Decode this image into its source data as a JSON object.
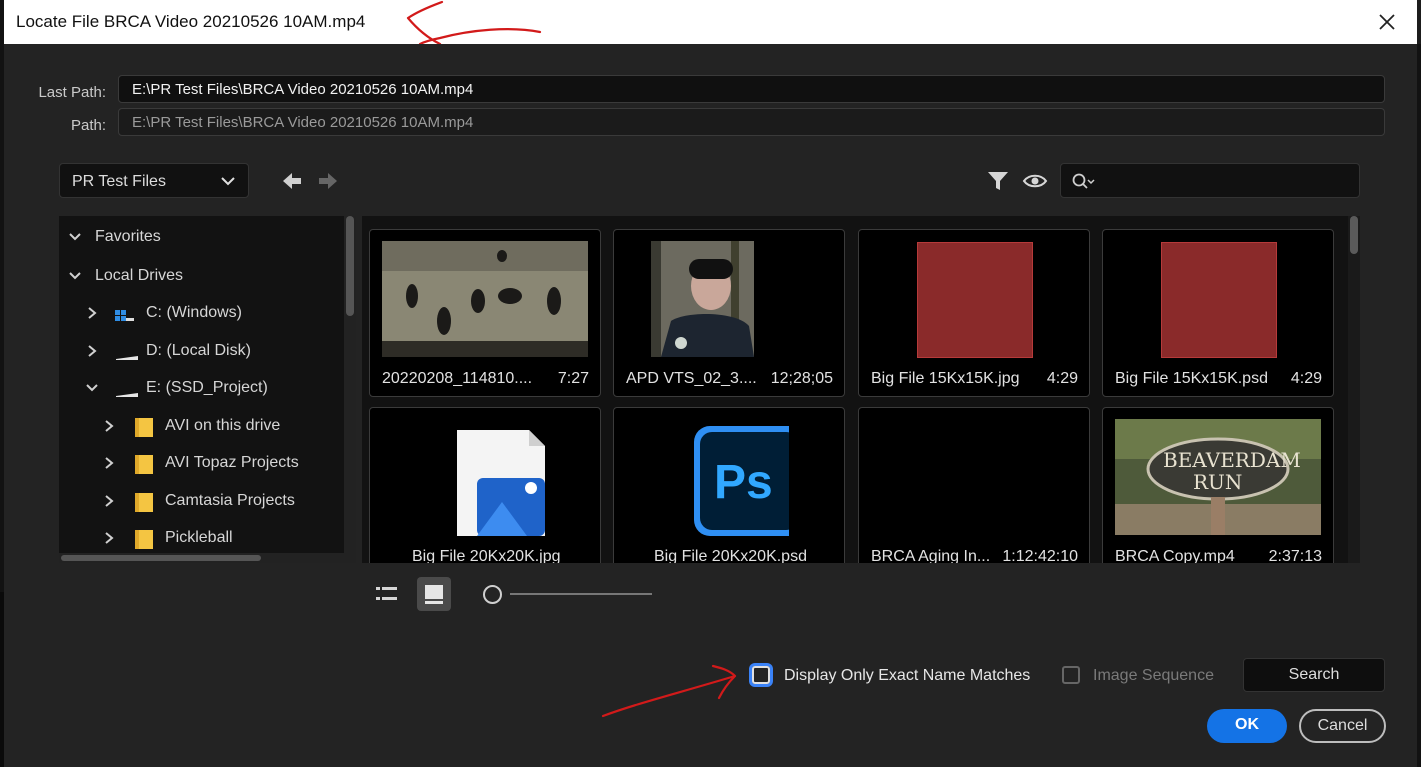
{
  "window": {
    "title": "Locate File BRCA Video 20210526 10AM.mp4"
  },
  "paths": {
    "last_path_label": "Last Path:",
    "last_path_value": "E:\\PR Test Files\\BRCA Video 20210526 10AM.mp4",
    "path_label": "Path:",
    "path_value": "E:\\PR Test Files\\BRCA Video 20210526 10AM.mp4"
  },
  "location": {
    "selected": "PR Test Files"
  },
  "search": {
    "placeholder": ""
  },
  "tree": [
    {
      "label": "Favorites",
      "icon": "none",
      "expanded": true
    },
    {
      "label": "Local Drives",
      "icon": "none",
      "expanded": true
    },
    {
      "label": "C: (Windows)",
      "icon": "windows-drive-icon",
      "expanded": false
    },
    {
      "label": "D: (Local Disk)",
      "icon": "drive-icon",
      "expanded": false
    },
    {
      "label": "E: (SSD_Project)",
      "icon": "drive-icon",
      "expanded": true
    },
    {
      "label": "AVI on this drive",
      "icon": "folder-icon",
      "expanded": false
    },
    {
      "label": "AVI Topaz Projects",
      "icon": "folder-icon",
      "expanded": false
    },
    {
      "label": "Camtasia Projects",
      "icon": "folder-icon",
      "expanded": false
    },
    {
      "label": "Pickleball",
      "icon": "folder-icon",
      "expanded": false
    }
  ],
  "files": [
    {
      "name": "20220208_114810....",
      "duration": "7:27",
      "thumb": "video-frame-otters"
    },
    {
      "name": "APD VTS_02_3....",
      "duration": "12;28;05",
      "thumb": "video-frame-man"
    },
    {
      "name": "Big File 15Kx15K.jpg",
      "duration": "4:29",
      "thumb": "red-square"
    },
    {
      "name": "Big File 15Kx15K.psd",
      "duration": "4:29",
      "thumb": "red-square"
    },
    {
      "name": "Big File 20Kx20K.jpg",
      "duration": "",
      "thumb": "image-file-icon"
    },
    {
      "name": "Big File 20Kx20K.psd",
      "duration": "",
      "thumb": "photoshop-icon"
    },
    {
      "name": "BRCA Aging In...",
      "duration": "1:12:42:10",
      "thumb": "black"
    },
    {
      "name": "BRCA Copy.mp4",
      "duration": "2:37:13",
      "thumb": "video-frame-sign"
    }
  ],
  "options": {
    "exact_match_label": "Display Only Exact Name Matches",
    "image_sequence_label": "Image Sequence",
    "search_button": "Search"
  },
  "buttons": {
    "ok": "OK",
    "cancel": "Cancel"
  },
  "colors": {
    "accent": "#1473e6",
    "annotation": "#d21a1a",
    "thumb_red": "#8a2a2a"
  }
}
